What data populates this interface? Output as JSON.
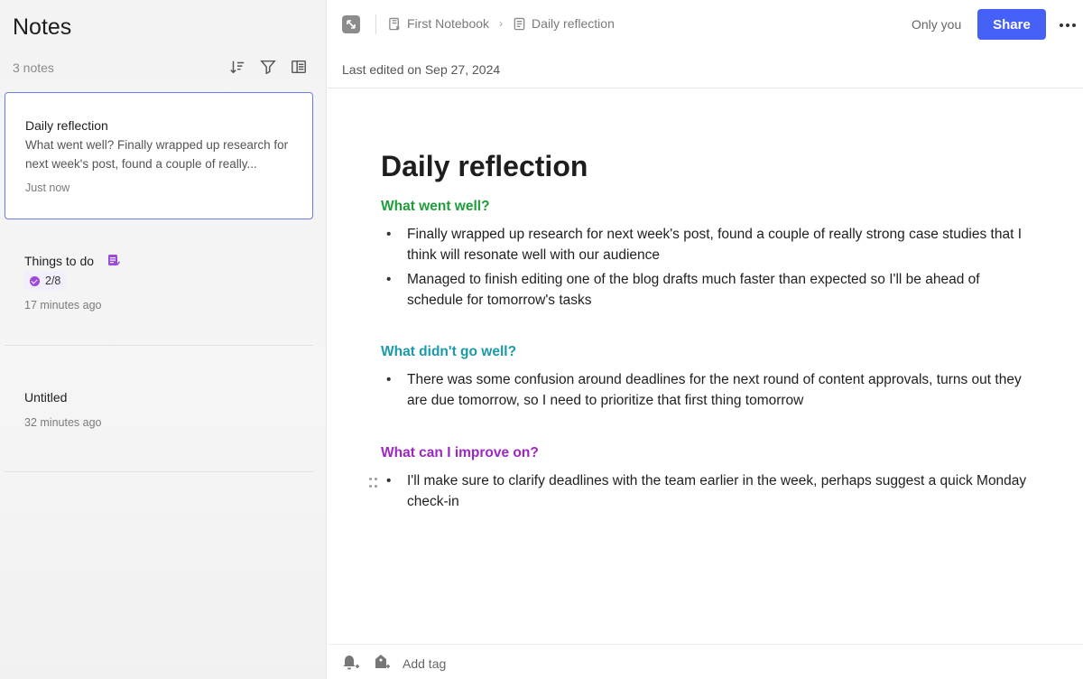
{
  "sidebar": {
    "title": "Notes",
    "count": "3 notes",
    "tools": [
      "sort-icon",
      "filter-icon",
      "view-layout-icon"
    ],
    "notes": [
      {
        "title": "Daily reflection",
        "snippet": "What went well? Finally wrapped up research for next week's post, found a couple of really...",
        "time": "Just now"
      },
      {
        "title": "Things to do",
        "tasks": "2/8",
        "time": "17 minutes ago"
      },
      {
        "title": "Untitled",
        "time": "32 minutes ago"
      }
    ]
  },
  "topbar": {
    "breadcrumb": [
      "First Notebook",
      "Daily reflection"
    ],
    "visibility": "Only you",
    "share_label": "Share"
  },
  "editor": {
    "last_edited": "Last edited on Sep 27, 2024",
    "title": "Daily reflection",
    "sections": [
      {
        "heading": "What went well?",
        "color": "#1e9e3a",
        "bullets": [
          "Finally wrapped up research for next week's post, found a couple of really strong case studies that I think will resonate well with our audience",
          "Managed to finish editing one of the blog drafts much faster than expected so I'll be ahead of schedule for tomorrow's tasks"
        ]
      },
      {
        "heading": "What didn't go well?",
        "color": "#1a9aa6",
        "bullets": [
          "There was some confusion around deadlines for the next round of content approvals, turns out they are due tomorrow, so I need to prioritize that first thing tomorrow"
        ]
      },
      {
        "heading": "What can I improve on?",
        "color": "#9c27c2",
        "bullets": [
          "I'll make sure to clarify deadlines with the team earlier in the week, perhaps suggest a quick Monday check-in"
        ]
      }
    ]
  },
  "footer": {
    "add_tag": "Add tag"
  },
  "colors": {
    "accent": "#4460f7",
    "active_border": "#6a7cf0"
  }
}
